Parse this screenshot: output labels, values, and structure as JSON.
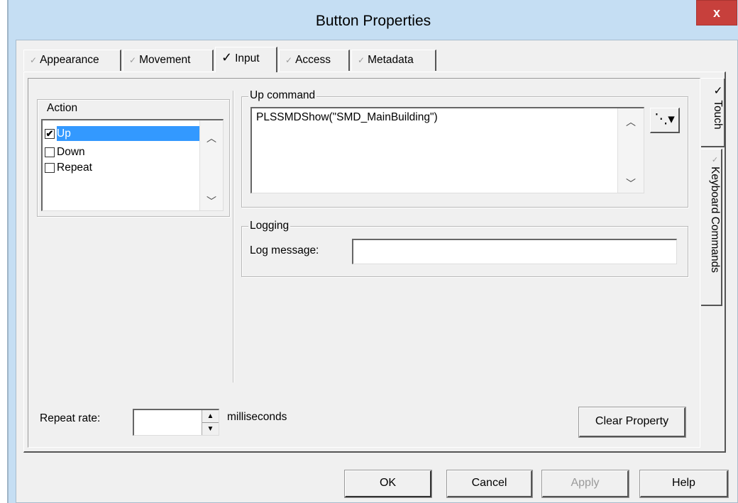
{
  "window": {
    "title": "Button Properties",
    "close_label": "x"
  },
  "tabs": [
    {
      "label": "Appearance",
      "active": false
    },
    {
      "label": "Movement",
      "active": false
    },
    {
      "label": "Input",
      "active": true
    },
    {
      "label": "Access",
      "active": false
    },
    {
      "label": "Metadata",
      "active": false
    }
  ],
  "side_tabs": [
    {
      "label": "Touch",
      "active": true
    },
    {
      "label": "Keyboard Commands",
      "active": false
    }
  ],
  "action_group": {
    "label": "Action",
    "items": [
      {
        "label": "Up",
        "checked": true,
        "selected": true
      },
      {
        "label": "Down",
        "checked": false,
        "selected": false
      },
      {
        "label": "Repeat",
        "checked": false,
        "selected": false
      }
    ]
  },
  "up_command": {
    "label": "Up command",
    "value": "PLSSMDShow(\"SMD_MainBuilding\")"
  },
  "logging": {
    "label": "Logging",
    "log_message_label": "Log message:",
    "log_message_value": ""
  },
  "repeat_rate": {
    "label": "Repeat rate:",
    "value": "",
    "units": "milliseconds"
  },
  "clear_property_label": "Clear Property",
  "dialog_buttons": {
    "ok": "OK",
    "cancel": "Cancel",
    "apply": "Apply",
    "help": "Help"
  },
  "colors": {
    "titlebar": "#c5def3",
    "close": "#c7403c",
    "selection": "#3399ff",
    "face": "#f0f0f0"
  }
}
